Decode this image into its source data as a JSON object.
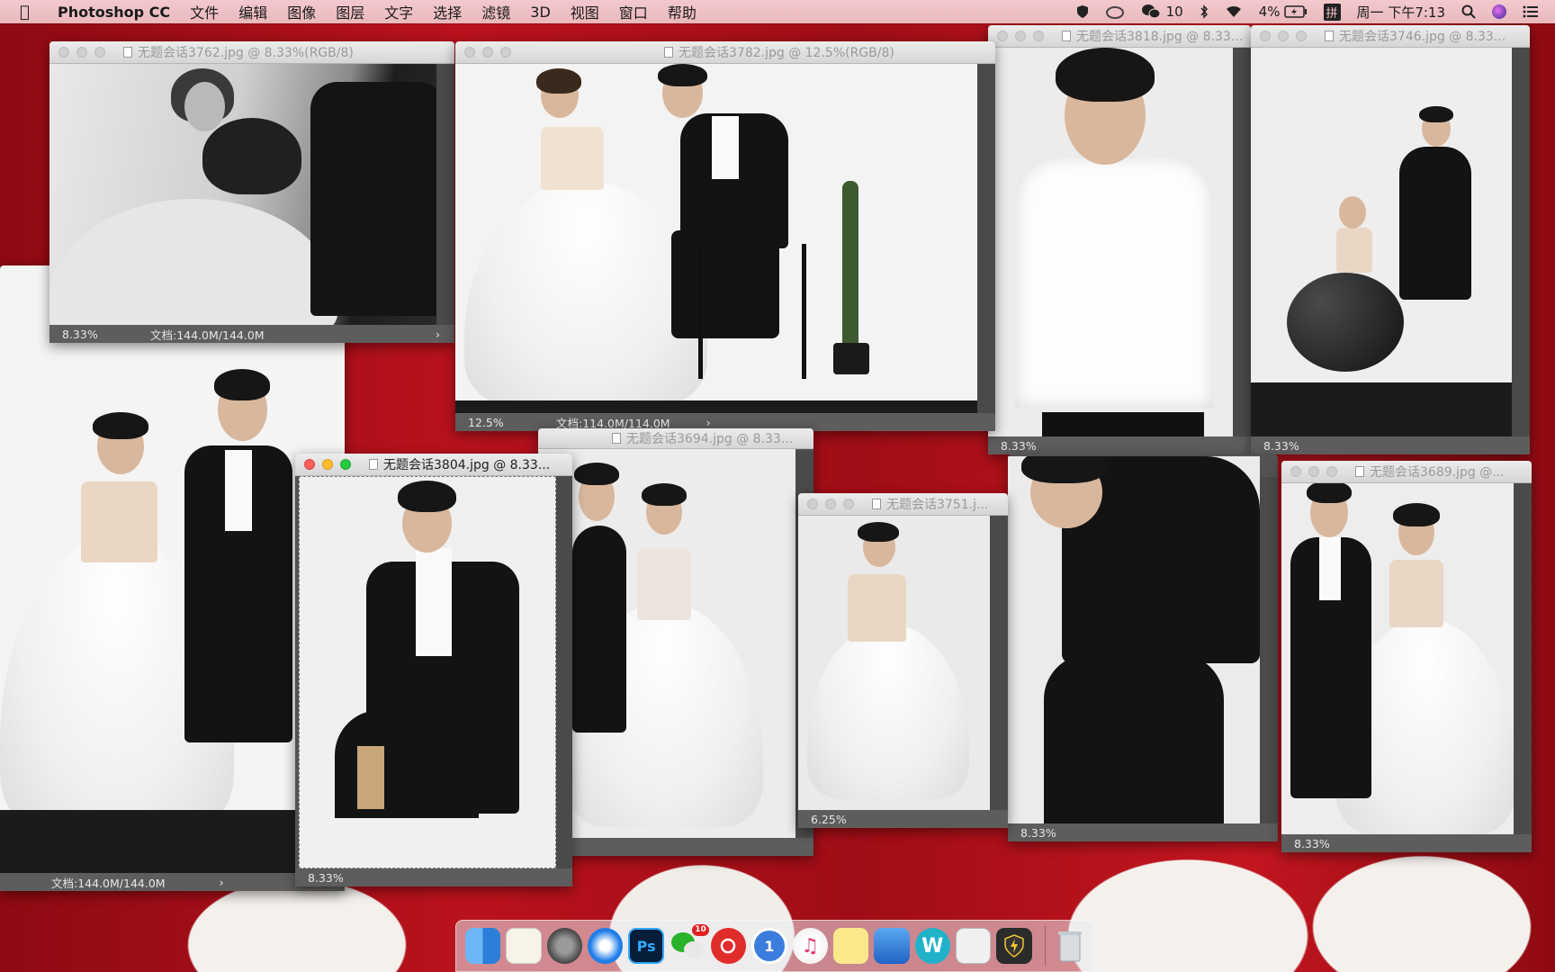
{
  "menubar": {
    "app_name": "Photoshop CC",
    "menus": [
      "文件",
      "编辑",
      "图像",
      "图层",
      "文字",
      "选择",
      "滤镜",
      "3D",
      "视图",
      "窗口",
      "帮助"
    ],
    "wechat_count": "10",
    "battery": "4%",
    "input_method": "拼",
    "clock": "周一 下午7:13"
  },
  "windows": [
    {
      "title": "无题会话3762.jpg @ 8.33%(RGB/8)",
      "zoom": "8.33%",
      "doc": "文档:144.0M/144.0M"
    },
    {
      "title": "无题会话3782.jpg @ 12.5%(RGB/8)",
      "zoom": "12.5%",
      "doc": "文档:114.0M/114.0M"
    },
    {
      "title": "无题会话3818.jpg @ 8.33...",
      "zoom": "8.33%"
    },
    {
      "title": "无题会话3746.jpg @ 8.33...",
      "zoom": "8.33%"
    },
    {
      "doc": "文档:144.0M/144.0M"
    },
    {
      "title": "无题会话3804.jpg @ 8.33...",
      "zoom": "8.33%"
    },
    {
      "title": "无题会话3694.jpg @ 8.33...",
      "zoom": "%"
    },
    {
      "title": "无题会话3751.j...",
      "zoom": "6.25%"
    },
    {
      "zoom": "8.33%"
    },
    {
      "title": "无题会话3689.jpg @...",
      "zoom": "8.33%"
    }
  ],
  "dock": {
    "apps": [
      "finder-icon",
      "notes-icon",
      "system-preferences-icon",
      "safari-icon",
      "photoshop-icon",
      "wechat-icon",
      "netease-music-icon",
      "1password-icon",
      "itunes-icon",
      "stickies-icon",
      "keynote-icon",
      "w-app-icon",
      "preview-icon",
      "vpn-shield-icon",
      "trash-icon"
    ],
    "photoshop_label": "Ps",
    "w_label": "W",
    "onepass_label": "1",
    "wechat_badge": "10"
  }
}
